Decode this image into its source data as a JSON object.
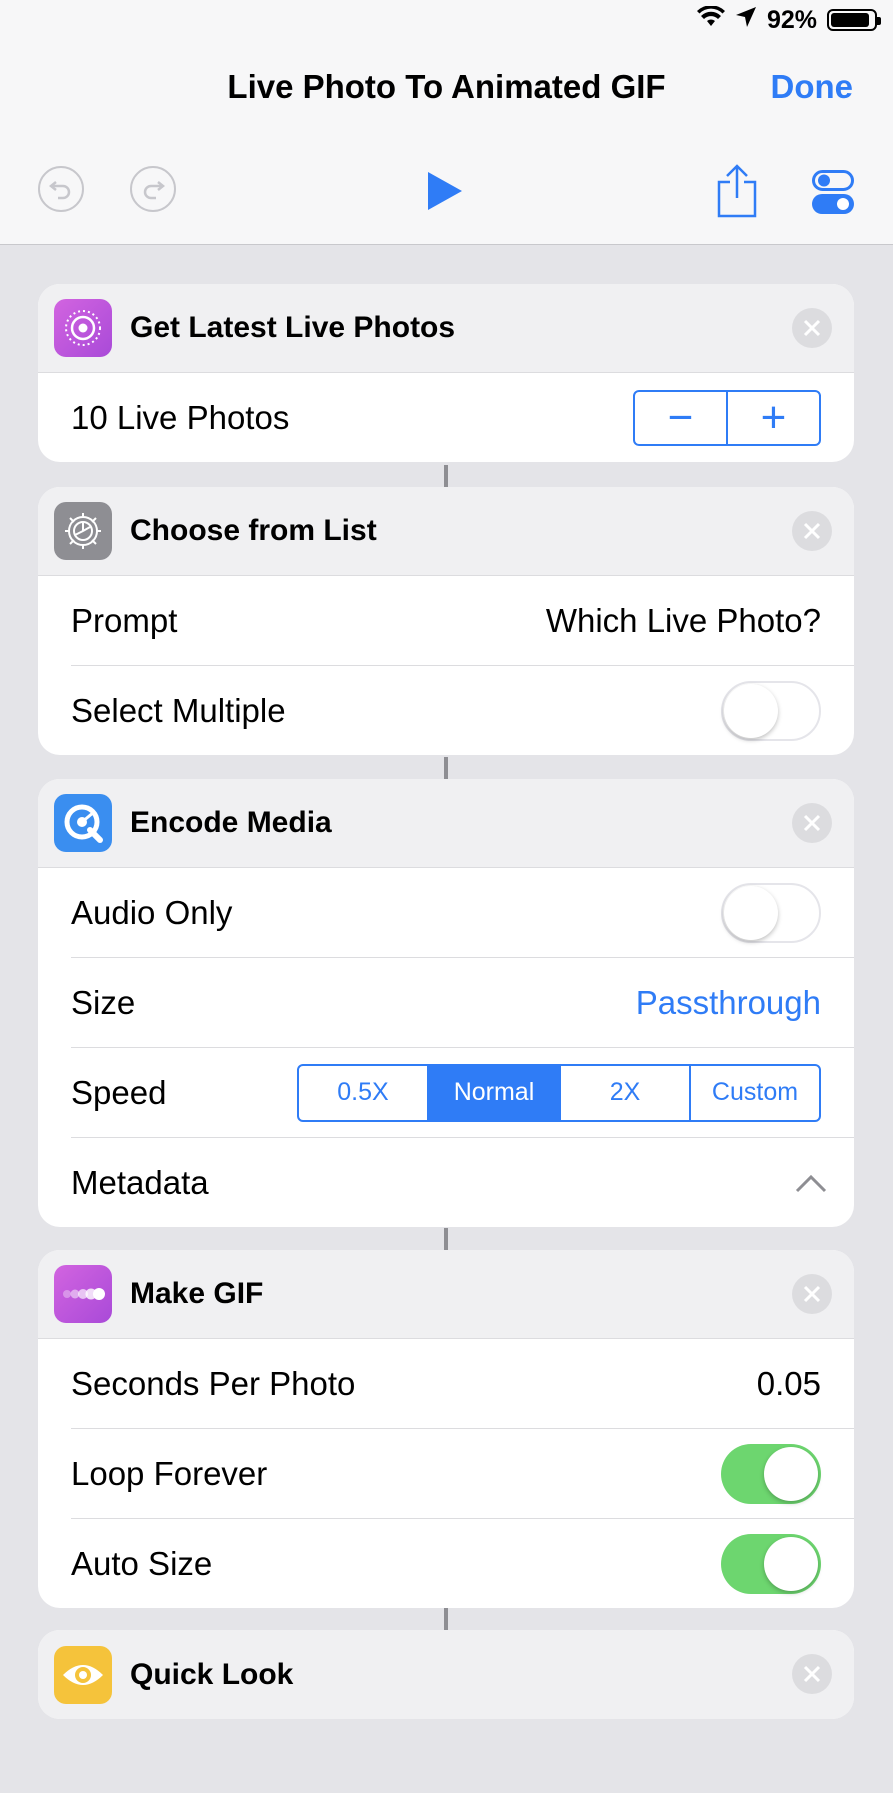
{
  "status": {
    "battery": "92%",
    "battery_level": 0.92
  },
  "nav": {
    "title": "Live Photo To Animated GIF",
    "done_label": "Done"
  },
  "toolbar": {
    "undo_icon": "undo-icon",
    "redo_icon": "redo-icon",
    "play_icon": "play-icon",
    "share_icon": "share-icon",
    "settings_icon": "toggles-icon",
    "accent": "#2f7cf6"
  },
  "actions": {
    "get_latest": {
      "title": "Get Latest Live Photos",
      "count_label": "10 Live Photos",
      "minus": "−",
      "plus": "+"
    },
    "choose_list": {
      "title": "Choose from List",
      "prompt_label": "Prompt",
      "prompt_value": "Which Live Photo?",
      "multiple_label": "Select Multiple",
      "multiple_on": false
    },
    "encode_media": {
      "title": "Encode Media",
      "audio_label": "Audio Only",
      "audio_on": false,
      "size_label": "Size",
      "size_value": "Passthrough",
      "speed_label": "Speed",
      "speed_options": [
        "0.5X",
        "Normal",
        "2X",
        "Custom"
      ],
      "speed_selected": "Normal",
      "metadata_label": "Metadata"
    },
    "make_gif": {
      "title": "Make GIF",
      "seconds_label": "Seconds Per Photo",
      "seconds_value": "0.05",
      "loop_label": "Loop Forever",
      "loop_on": true,
      "autosize_label": "Auto Size",
      "autosize_on": true
    },
    "quick_look": {
      "title": "Quick Look"
    }
  },
  "colors": {
    "accent": "#2f7cf6",
    "toggle_on": "#6dd66f",
    "photos_icon": "#c94fd6",
    "settings_icon": "#8e8e93",
    "encode_icon": "#3a8ef0",
    "gif_icon": "#c94fd6",
    "quicklook_icon": "#f5c33b"
  }
}
